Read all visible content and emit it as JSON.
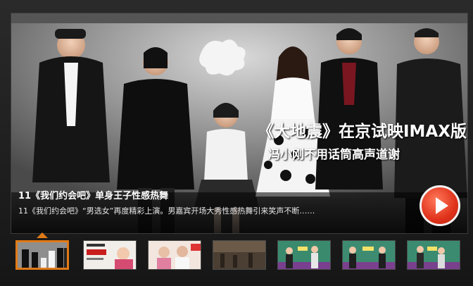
{
  "slide": {
    "caption_title": "11《我们约会吧》单身王子性感热舞",
    "caption_desc": "11《我们约会吧》“男选女”再度精彩上演。男嘉宾开场大秀性感热舞引来笑声不断……",
    "overlay_title": "《大地震》在京试映IMAX版",
    "overlay_subtitle": "冯小刚不用话筒高声道谢"
  },
  "thumbnails": {
    "count": 7,
    "active_index": 0
  },
  "colors": {
    "accent": "#e07a16",
    "play_button": "#e0321b"
  }
}
